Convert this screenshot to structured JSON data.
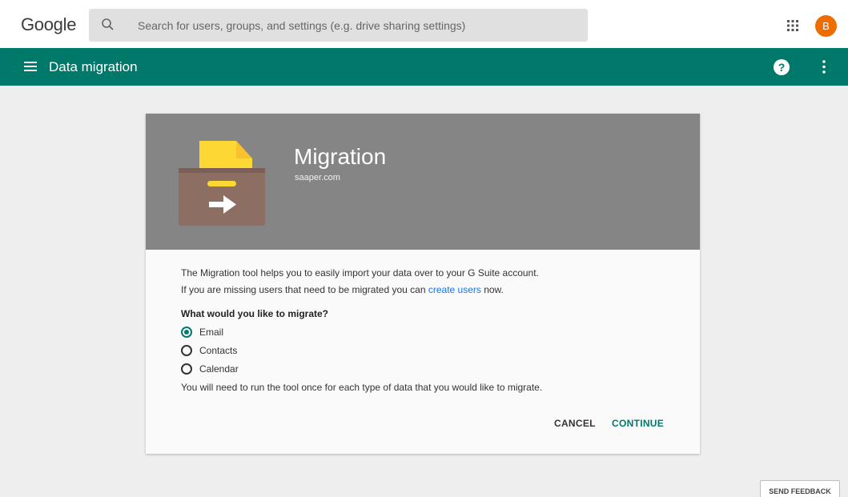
{
  "topbar": {
    "logo": "Google",
    "search_placeholder": "Search for users, groups, and settings (e.g. drive sharing settings)",
    "apps_icon": "apps-grid-icon",
    "avatar_letter": "B",
    "avatar_color": "#ef6c00"
  },
  "header": {
    "title": "Data migration",
    "menu_icon": "hamburger-menu-icon",
    "help_label": "?",
    "more_icon": "more-vert-icon",
    "color": "#00796b"
  },
  "card": {
    "title": "Migration",
    "domain": "saaper.com",
    "intro_line1": "The Migration tool helps you to easily import your data over to your G Suite account.",
    "intro_line2_prefix": "If you are missing users that need to be migrated you can ",
    "intro_line2_link": "create users",
    "intro_line2_suffix": " now.",
    "question": "What would you like to migrate?",
    "options": [
      {
        "label": "Email",
        "selected": true
      },
      {
        "label": "Contacts",
        "selected": false
      },
      {
        "label": "Calendar",
        "selected": false
      }
    ],
    "note": "You will need to run the tool once for each type of data that you would like to migrate.",
    "cancel_label": "CANCEL",
    "continue_label": "CONTINUE"
  },
  "feedback_label": "SEND FEEDBACK"
}
